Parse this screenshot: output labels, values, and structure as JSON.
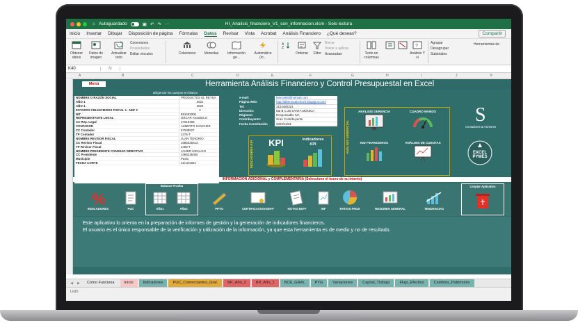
{
  "window": {
    "title": "HI_Analisis_financiero_V1_con_informacion.xlsm - Solo lectura",
    "autosave_label": "Autoguardado"
  },
  "menu": {
    "tabs": [
      "Inicio",
      "Insertar",
      "Dibujar",
      "Disposición de página",
      "Fórmulas",
      "Datos",
      "Revisar",
      "Vista",
      "Acrobat",
      "Análisis Financiero",
      "¿Qué deseas?"
    ],
    "active": "Datos",
    "share_label": "Compartir"
  },
  "ribbon": {
    "obtener_datos": "Obtener datos",
    "datos_imagen": "Datos de imagen",
    "actualizar_todo": "Actualizar todo",
    "conexiones": "Conexiones",
    "propiedades": "Propiedades",
    "editar_vinculos": "Editar vínculos",
    "colaciones": "Colaciones",
    "monedas": "Monedas",
    "informacion": "Información ge...",
    "automatico": "Automático (in...",
    "ordenar": "Ordenar",
    "filtro": "Filtro",
    "borrar": "Borrar",
    "volver_aplicar": "Volver a aplicar",
    "avanzadas": "Avanzadas",
    "texto_columnas": "Texto en columnas",
    "analisis": "Análisis Y si",
    "agrupar": "Agrupar",
    "desagrupar": "Desagrupar",
    "subtotales": "Subtotales",
    "herramientas": "Herramientas de"
  },
  "formula_bar": {
    "namebox": "K40",
    "fx": "fx"
  },
  "columns": [
    "A",
    "B",
    "C",
    "D",
    "E",
    "F",
    "G",
    "H",
    "I",
    "J",
    "K"
  ],
  "sheet": {
    "menu_button": "Menú",
    "title": "Herramienta Análisis Financiero y Control Presupuestal en Excel",
    "diligencie": "Diligencie los campos en blanco",
    "left_form": [
      {
        "label": "NOMBRE O RAZÓN SOCIAL",
        "value": "PRODUCTOS EL REYSA"
      },
      {
        "label": "AÑO 1",
        "value": "2021"
      },
      {
        "label": "AÑO 1",
        "value": "2020"
      },
      {
        "label": "ESTADOS FINANCIEROS FISCAL 1 - NIIF 2",
        "value": "2"
      },
      {
        "label": "NIT",
        "value": "891203000"
      },
      {
        "label": "REPRESENTANTE LEGAL",
        "value": "OSCAR AGUDELO"
      },
      {
        "label": "CC Rep. Legal",
        "value": "27019458"
      },
      {
        "label": "CONTADOR",
        "value": "ALBERTO SANCHEZ"
      },
      {
        "label": "CC Contador",
        "value": "87039527"
      },
      {
        "label": "TP Contador",
        "value": "2376-T"
      },
      {
        "label": "NOMBRE REVISOR FISCAL",
        "value": "JUAN TENORIO"
      },
      {
        "label": "CC Revisor Fiscal",
        "value": "1085325013"
      },
      {
        "label": "TP Revisor Fiscal",
        "value": "2456-T"
      },
      {
        "label": "NOMBRE PRESIDENTE CONSEJO DIRECTIVO",
        "value": "JAVIER HIDALGO"
      },
      {
        "label": "CC Presidente",
        "value": "1085335055"
      },
      {
        "label": "Municipio",
        "value": "Pasto"
      },
      {
        "label": "FECHA CORTE",
        "value": "31/12/2021"
      }
    ],
    "mid_form": [
      {
        "label": "e-mail:",
        "value": "betcos68@hotmail.com"
      },
      {
        "label": "Página Web:",
        "value": "http://albertosanchezh.blogspot.com/"
      },
      {
        "label": "Tel:",
        "value": "3153483323"
      },
      {
        "label": "Dirección:",
        "value": "MZ B C 28 SANTA MÓNICA"
      },
      {
        "label": "Régimen:",
        "value": "Responsable IVA"
      },
      {
        "label": "Contribuyente:",
        "value": "Gran Contribuyente"
      },
      {
        "label": "Fecha Constitución",
        "value": "2020/12/01"
      }
    ],
    "indicadores_kpi_vertical": "INDICADORES KPI",
    "kpi": "KPI",
    "indicadores_kpi": "Indicadores KPI",
    "analisis_gerencial_vertical": "ANÁLISIS GERENCIAL",
    "cards": {
      "analisis_gerencia": "ANÁLISIS GERENCIA",
      "cuadro_mando": "CUADRO MANDO",
      "ind_financieros": "IND FINANCIEROS",
      "analisis_cuentas": "ANÁLISIS DE CUENTAS"
    },
    "brand": {
      "contadores": "Contadores & Asesores",
      "excel": "EXCEL",
      "pymes": "PYMES"
    },
    "info_adicional": "INFORMACIÓN ADICIONAL y COMPLEMENTARIA (Seleccione el icono de su interés)",
    "balance_prueba": "Balance Prueba",
    "limpiar": "Limpiar Aplicativo",
    "icons": [
      "INDICADORES",
      "PUC",
      "AÑo1",
      "AÑo2",
      "PPTO",
      "CERTIFICACION EEFF",
      "NOTAS EEFF",
      "INF",
      "RATIOS FROS",
      "RESUMEN GENERAL",
      "TENDENCIAS"
    ],
    "info_text": [
      "Este aplicativo lo orienta en la preparación de informes de gestión y la generación de indicadores financieros.",
      "El usuario es el único responsable de la verificación y utilización de la información, ya que esta herramienta es de medio y no de resultado."
    ]
  },
  "sheet_tabs": [
    {
      "label": "Como Funciona",
      "color": "#e8e8e8"
    },
    {
      "label": "Inicio",
      "color": "#f6c7c7"
    },
    {
      "label": "Indicadores",
      "color": "#79b3ad"
    },
    {
      "label": "PUC_Comerciantes_Gral.",
      "color": "#e1a83a"
    },
    {
      "label": "BP_Año_2",
      "color": "#e06666"
    },
    {
      "label": "BP_Año_1",
      "color": "#e06666"
    },
    {
      "label": "BCE_GRAL",
      "color": "#79b3ad"
    },
    {
      "label": "PYG",
      "color": "#79b3ad"
    },
    {
      "label": "Variaciones",
      "color": "#79b3ad"
    },
    {
      "label": "Capital_Trabajo",
      "color": "#79b3ad"
    },
    {
      "label": "Flujo_Efectivo",
      "color": "#79b3ad"
    },
    {
      "label": "Cambios_Patrimonio",
      "color": "#79b3ad"
    }
  ],
  "status": "Listo"
}
